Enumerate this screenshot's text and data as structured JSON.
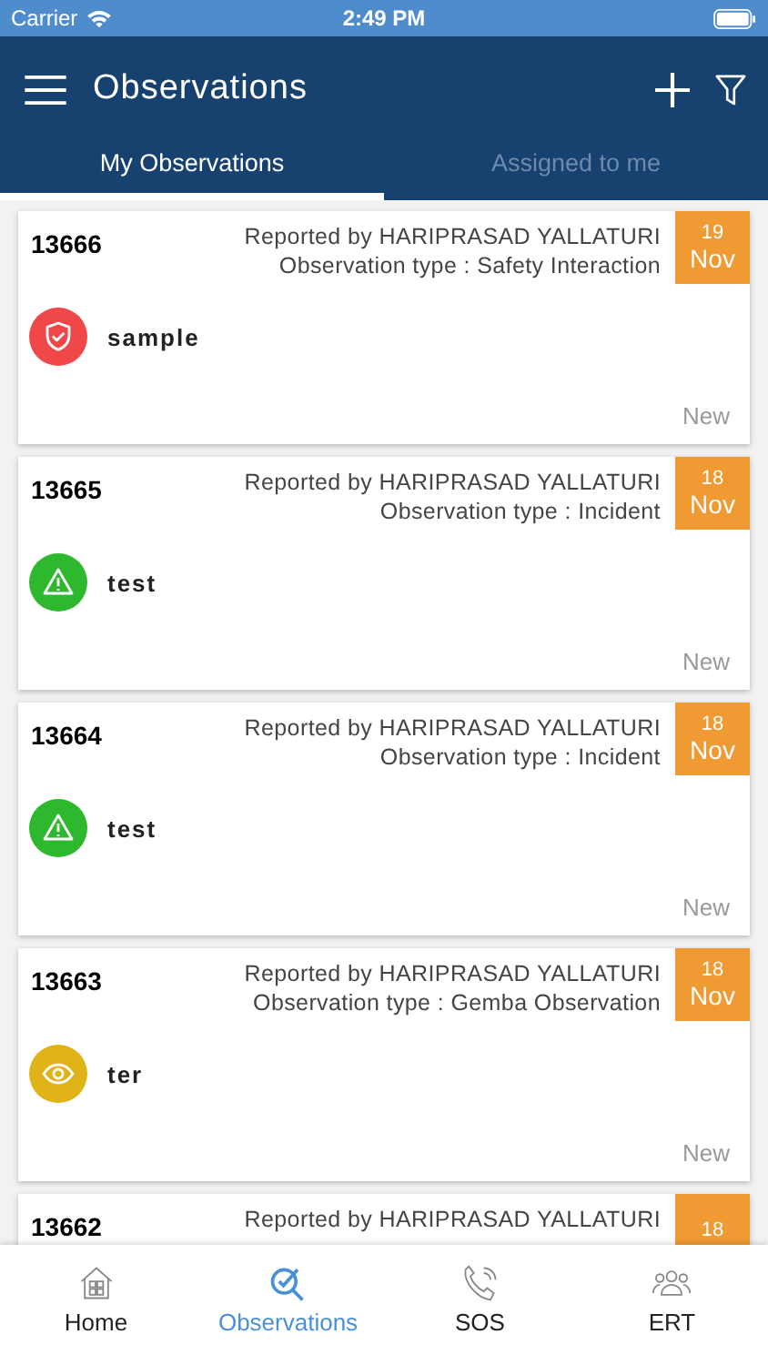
{
  "status_bar": {
    "carrier": "Carrier",
    "time": "2:49 PM"
  },
  "header": {
    "title": "Observations"
  },
  "tabs": [
    {
      "label": "My Observations",
      "selected": true
    },
    {
      "label": "Assigned to me",
      "selected": false
    }
  ],
  "observations": [
    {
      "id": "13666",
      "reported": "Reported by HARIPRASAD YALLATURI",
      "type": "Observation type : Safety Interaction",
      "day": "19",
      "month": "Nov",
      "kind": "shield",
      "color": "#f04848",
      "title": "sample",
      "status": "New"
    },
    {
      "id": "13665",
      "reported": "Reported by HARIPRASAD YALLATURI",
      "type": "Observation type : Incident",
      "day": "18",
      "month": "Nov",
      "kind": "warning",
      "color": "#2eb82e",
      "title": "test",
      "status": "New"
    },
    {
      "id": "13664",
      "reported": "Reported by HARIPRASAD YALLATURI",
      "type": "Observation type : Incident",
      "day": "18",
      "month": "Nov",
      "kind": "warning",
      "color": "#2eb82e",
      "title": "test",
      "status": "New"
    },
    {
      "id": "13663",
      "reported": "Reported by HARIPRASAD YALLATURI",
      "type": "Observation type : Gemba Observation",
      "day": "18",
      "month": "Nov",
      "kind": "eye",
      "color": "#e0b318",
      "title": "ter",
      "status": "New"
    },
    {
      "id": "13662",
      "reported": "Reported by HARIPRASAD YALLATURI",
      "day": "18"
    }
  ],
  "nav": [
    {
      "label": "Home",
      "kind": "home",
      "selected": false
    },
    {
      "label": "Observations",
      "kind": "observe",
      "selected": true
    },
    {
      "label": "SOS",
      "kind": "phone",
      "selected": false
    },
    {
      "label": "ERT",
      "kind": "group",
      "selected": false
    }
  ]
}
